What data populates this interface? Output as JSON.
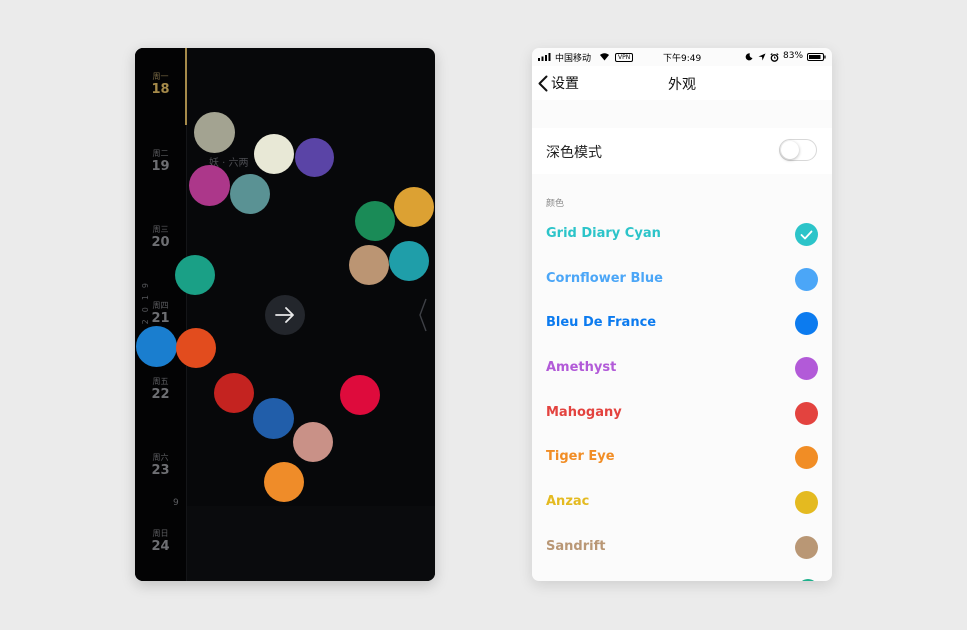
{
  "dark_screen": {
    "year": "2019",
    "ghost_text": "妖 · 六两",
    "hour_label": "9",
    "days": [
      {
        "weekday": "周一",
        "date": "18",
        "active": true
      },
      {
        "weekday": "周二",
        "date": "19"
      },
      {
        "weekday": "周三",
        "date": "20"
      },
      {
        "weekday": "周四",
        "date": "21"
      },
      {
        "weekday": "周五",
        "date": "22"
      },
      {
        "weekday": "周六",
        "date": "23"
      },
      {
        "weekday": "周日",
        "date": "24"
      }
    ],
    "dot_colors": [
      "#a3a391",
      "#e8e8d6",
      "#5a44a6",
      "#ac378a",
      "#5a9294",
      "#1a8b57",
      "#dca133",
      "#1aa086",
      "#bb9573",
      "#1f9ea9",
      "#1a7ecf",
      "#e24c1e",
      "#c42320",
      "#de0b3c",
      "#215eaa",
      "#c99187",
      "#ef8c29"
    ],
    "icons": [
      "arrow-right-icon",
      "chevron-left-icon"
    ]
  },
  "settings_screen": {
    "status": {
      "carrier": "中国移动",
      "vpn": "VPN",
      "time": "下午9:49",
      "battery": "83%"
    },
    "nav": {
      "back_label": "设置",
      "title": "外观"
    },
    "dark_mode": {
      "label": "深色模式",
      "enabled": false
    },
    "section_label": "颜色",
    "colors": [
      {
        "name": "Grid Diary Cyan",
        "hex": "#2cc4c9",
        "selected": true
      },
      {
        "name": "Cornflower Blue",
        "hex": "#4ba6f7"
      },
      {
        "name": "Bleu De France",
        "hex": "#0c7bef"
      },
      {
        "name": "Amethyst",
        "hex": "#b25ad8"
      },
      {
        "name": "Mahogany",
        "hex": "#e3433f"
      },
      {
        "name": "Tiger Eye",
        "hex": "#f18d25"
      },
      {
        "name": "Anzac",
        "hex": "#e4ba20"
      },
      {
        "name": "Sandrift",
        "hex": "#b99775"
      }
    ],
    "partial_swatch_color": "#1fb08c",
    "icons": [
      "signal-icon",
      "wifi-icon",
      "moon-icon",
      "location-icon",
      "alarm-icon",
      "battery-icon",
      "back-chevron-icon",
      "checkmark-icon"
    ]
  }
}
